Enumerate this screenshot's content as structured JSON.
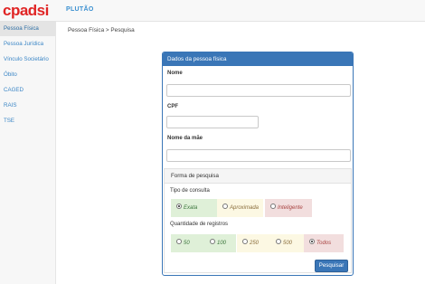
{
  "header": {
    "logo": "cpadsi",
    "brand": "PLUTÃO"
  },
  "sidebar": {
    "items": [
      {
        "label": "Pessoa Física"
      },
      {
        "label": "Pessoa Jurídica"
      },
      {
        "label": "Vínculo Societário"
      },
      {
        "label": "Óbito"
      },
      {
        "label": "CAGED"
      },
      {
        "label": "RAIS"
      },
      {
        "label": "TSE"
      }
    ]
  },
  "breadcrumb": "Pessoa Física > Pesquisa",
  "form": {
    "title": "Dados da pessoa física",
    "nome_label": "Nome",
    "nome_value": "",
    "cpf_label": "CPF",
    "cpf_value": "",
    "mae_label": "Nome da mãe",
    "mae_value": "",
    "forma": {
      "title": "Forma de pesquisa",
      "tipo_label": "Tipo de consulta",
      "tipo_options": [
        "Exata",
        "Aproximada",
        "Inteligente"
      ],
      "tipo_selected": "Exata",
      "qtd_label": "Quantidade de registros",
      "qtd_options": [
        "50",
        "100",
        "250",
        "500",
        "Todos"
      ],
      "qtd_selected": "Todos"
    },
    "submit_label": "Pesquisar"
  },
  "colors": {
    "brand_red": "#e02424",
    "primary": "#3a76b7",
    "link": "#3b86c6"
  }
}
